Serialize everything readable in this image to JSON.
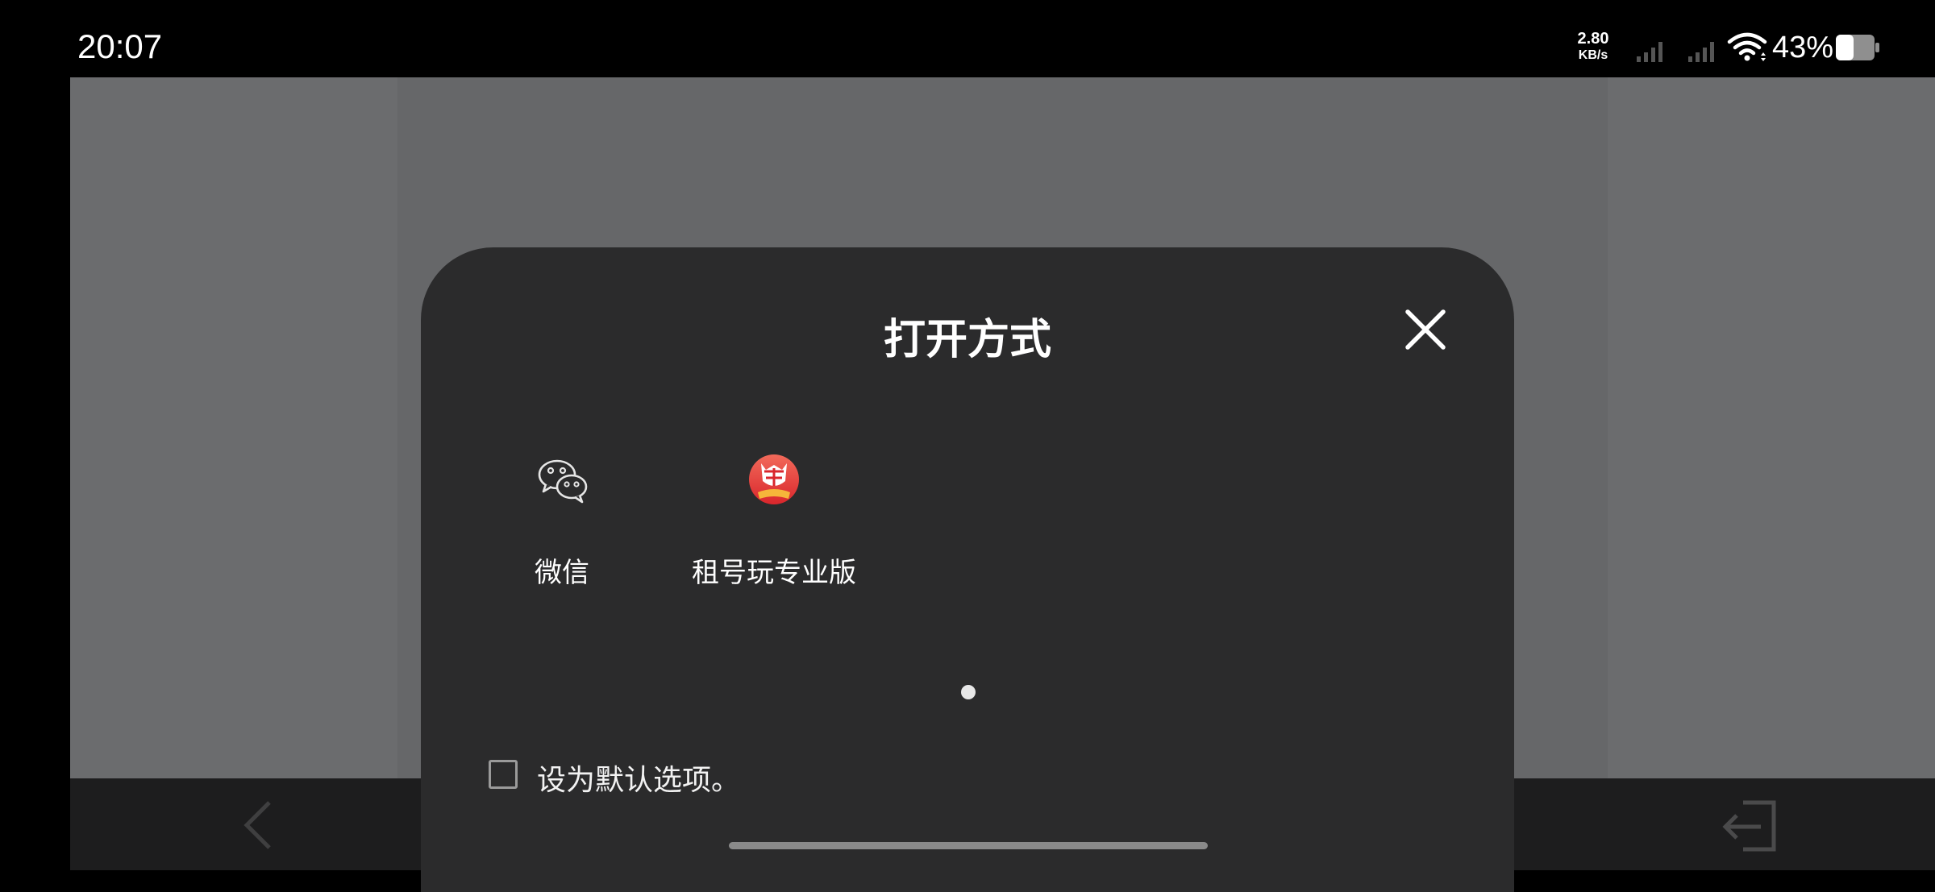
{
  "status_bar": {
    "time": "20:07",
    "net_speed_value": "2.80",
    "net_speed_unit": "KB/s",
    "battery_percent": "43%",
    "battery_level": 0.43
  },
  "dialog": {
    "title": "打开方式",
    "apps": [
      {
        "label": "微信",
        "icon": "wechat-icon"
      },
      {
        "label": "租号玩专业版",
        "icon": "zuhaowan-app-icon"
      }
    ],
    "set_default_label": "设为默认选项。",
    "set_default_checked": false
  },
  "colors": {
    "sheet_bg": "#2b2b2c",
    "scrim": "#666769",
    "zuhaowan_red": "#e8403a"
  }
}
